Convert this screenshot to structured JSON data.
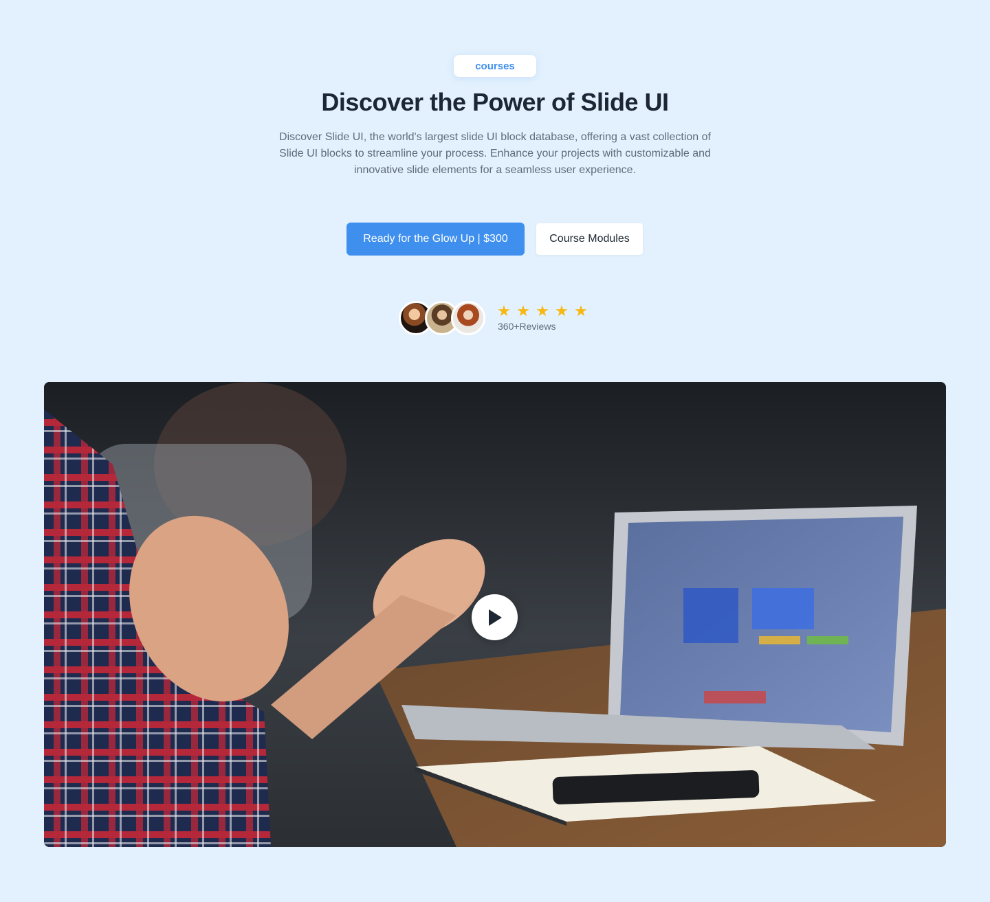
{
  "hero": {
    "badge": "courses",
    "title": "Discover the Power of Slide UI",
    "subtitle": "Discover Slide UI, the world's largest slide UI block database, offering a vast collection of Slide UI blocks to streamline your process. Enhance your projects with customizable and innovative slide elements for a seamless user experience.",
    "primary_button": "Ready for the Glow Up | $300",
    "secondary_button": "Course Modules"
  },
  "social_proof": {
    "rating": 5,
    "max_rating": 5,
    "reviews_label": "360+Reviews",
    "avatars": [
      "avatar-1",
      "avatar-2",
      "avatar-3"
    ]
  },
  "media": {
    "play_icon": "play-icon"
  },
  "colors": {
    "background": "#e3f1fe",
    "accent": "#3f8fee",
    "heading": "#1d2733",
    "body": "#5f6b78",
    "star": "#f6b812"
  }
}
